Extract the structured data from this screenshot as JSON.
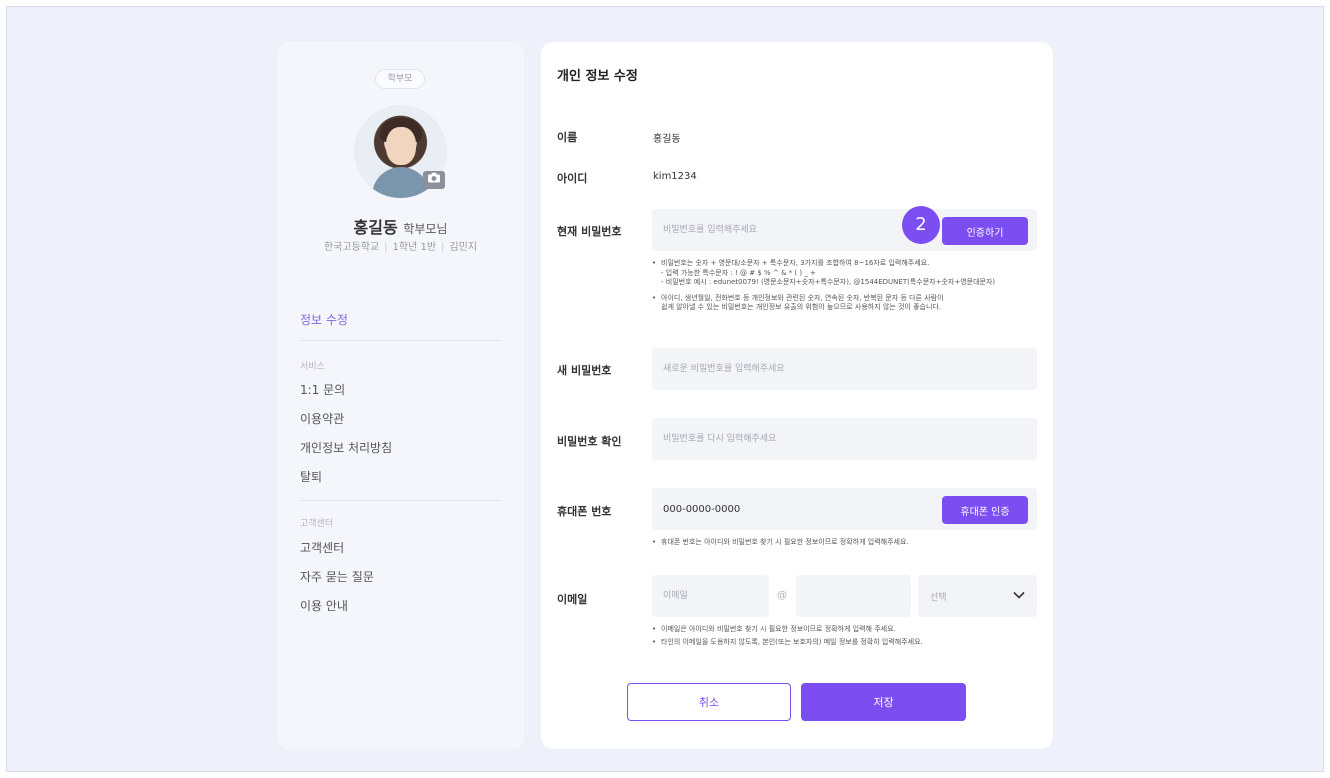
{
  "profile": {
    "role_chip": "학부모",
    "name": "홍길동",
    "name_suffix": "학부모님",
    "school": "한국고등학교",
    "grade": "1학년 1반",
    "child": "김민지",
    "camera_icon": "camera-icon"
  },
  "sidebar": {
    "active": "정보 수정",
    "groups": [
      {
        "label": "서비스",
        "items": [
          "1:1 문의",
          "이용약관",
          "개인정보 처리방침",
          "탈퇴"
        ]
      },
      {
        "label": "고객센터",
        "items": [
          "고객센터",
          "자주 묻는 질문",
          "이용 안내"
        ]
      }
    ]
  },
  "form": {
    "title": "개인 정보 수정",
    "name_label": "이름",
    "name_value": "홍길동",
    "id_label": "아이디",
    "id_value": "kim1234",
    "current_pw_label": "현재 비밀번호",
    "current_pw_placeholder": "비밀번호를 입력해주세요",
    "verify_button": "인증하기",
    "step_number": "2",
    "pw_notes": [
      "비밀번호는 숫자 + 영문대/소문자 + 특수문자, 3가지를 조합하여 8~16자로 입력해주세요.",
      "- 입력 가능한 특수문자 : ! @ # $ % ^ & * ( ) _ +",
      "- 비밀번호 예시 : edunet0079! (영문소문자+숫자+특수문자), @1544EDUNET(특수문자+숫자+영문대문자)",
      "아이디, 생년월일, 전화번호 등 개인정보와 관련된 숫자, 연속된 숫자, 반복된 문자 등 다른 사람이",
      "쉽게 알아낼 수 있는 비밀번호는 개인정보 유출의 위험이 높으므로 사용하지 않는 것이 좋습니다."
    ],
    "new_pw_label": "새 비밀번호",
    "new_pw_placeholder": "새로운 비밀번호를 입력해주세요",
    "confirm_pw_label": "비밀번호 확인",
    "confirm_pw_placeholder": "비밀번호를 다시 입력해주세요",
    "phone_label": "휴대폰 번호",
    "phone_value": "000-0000-0000",
    "phone_button": "휴대폰 인증",
    "phone_note": "휴대폰 번호는 아이디와 비밀번호 찾기 시 필요한 정보이므로 정확하게 입력해주세요.",
    "email_label": "이메일",
    "email_placeholder": "이메일",
    "email_at": "@",
    "email_domain_placeholder": "",
    "email_select": "선택",
    "email_notes": [
      "이메일은 아이디와 비밀번호 찾기 시 필요한 정보이므로 정확하게 입력해 주세요.",
      "타인의 이메일을 도용하지 않도록, 본인(또는 보호자의) 메일 정보를 정확히 입력해주세요."
    ],
    "cancel_button": "취소",
    "save_button": "저장"
  },
  "colors": {
    "accent": "#7c4df0",
    "sidebar_active": "#7d6ad8",
    "background": "#eef0fa"
  }
}
